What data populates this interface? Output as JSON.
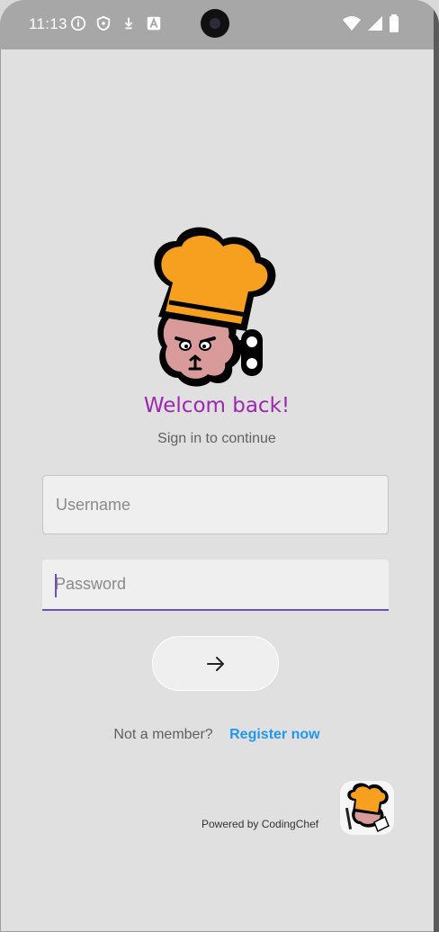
{
  "status_bar": {
    "time": "11:13",
    "left_icons": [
      "info-icon",
      "shield-icon",
      "download-icon",
      "font-a-icon"
    ],
    "right_icons": [
      "wifi-icon",
      "signal-icon",
      "battery-icon"
    ]
  },
  "login": {
    "title": "Welcom back!",
    "subtitle": "Sign in to continue",
    "username_placeholder": "Username",
    "password_placeholder": "Password",
    "submit_icon": "arrow-right-icon"
  },
  "footer": {
    "not_member_text": "Not a member?",
    "register_text": "Register now",
    "powered_by": "Powered by CodingChef"
  },
  "colors": {
    "title": "#9c27b0",
    "link": "#2196f3",
    "focus": "#6b4fbb",
    "chef_hat": "#f7a020",
    "chef_face": "#d99a9a"
  }
}
